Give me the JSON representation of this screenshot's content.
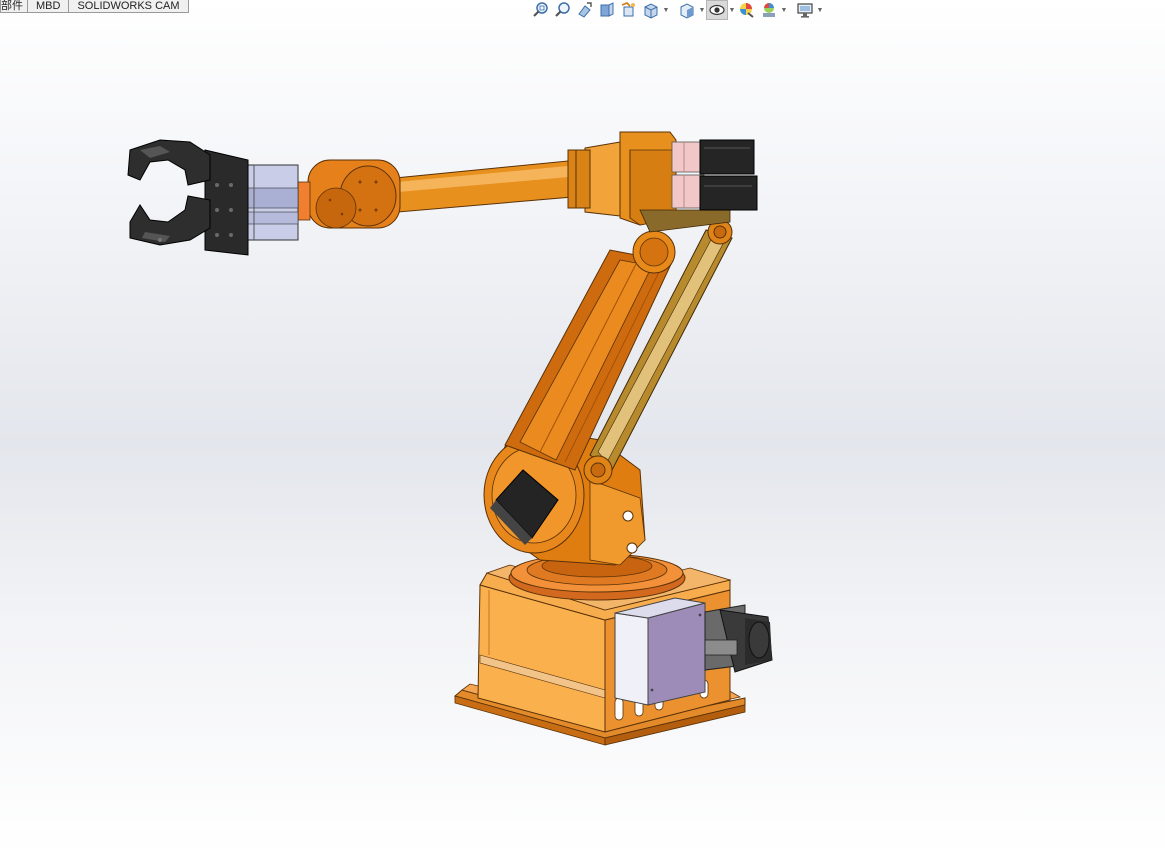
{
  "tabs": [
    {
      "label": "部件"
    },
    {
      "label": "MBD"
    },
    {
      "label": "SOLIDWORKS CAM"
    }
  ],
  "toolbar": {
    "buttons": [
      {
        "icon": "zoom-to-fit-icon"
      },
      {
        "icon": "zoom-to-area-icon"
      },
      {
        "icon": "previous-view-icon"
      },
      {
        "icon": "section-view-icon"
      },
      {
        "icon": "dynamic-annotation-icon"
      },
      {
        "icon": "view-orientation-icon"
      },
      {
        "icon": "display-style-icon"
      },
      {
        "icon": "hide-show-items-icon"
      },
      {
        "icon": "edit-appearance-icon"
      },
      {
        "icon": "apply-scene-icon"
      },
      {
        "icon": "view-settings-icon"
      }
    ]
  },
  "model": {
    "colors": {
      "body_orange": "#e07d10",
      "dark_orange": "#b85a05",
      "light_orange": "#f6a94a",
      "base_orange": "#f7a53c",
      "gripper_black": "#2a2a2a",
      "motor_black": "#232323",
      "control_box": "#9d8bb8",
      "cylinder_blue": "#c9cde8",
      "motor_pink": "#f2c7c7"
    }
  }
}
